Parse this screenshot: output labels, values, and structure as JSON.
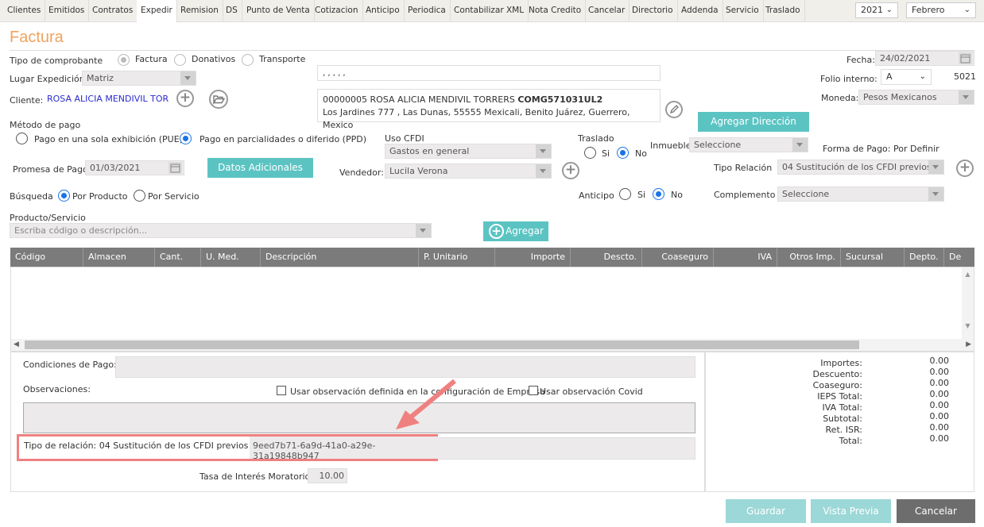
{
  "tabs": [
    "Clientes",
    "Emitidos",
    "Contratos",
    "Expedir",
    "Remision",
    "DS",
    "Punto de Venta",
    "Cotizacion",
    "Anticipo",
    "Periodica",
    "Contabilizar XML",
    "Nota Credito",
    "Cancelar",
    "Directorio",
    "Addenda",
    "Servicio",
    "Traslado"
  ],
  "year": "2021",
  "month": "Febrero",
  "title": "Factura",
  "tipo_comprobante": {
    "label": "Tipo de comprobante",
    "opts": [
      "Factura",
      "Donativos",
      "Transporte"
    ]
  },
  "lugar": {
    "label": "Lugar Expedición",
    "value": "Matriz"
  },
  "cliente": {
    "label": "Cliente:",
    "value": "ROSA ALICIA MENDIVIL TORRE"
  },
  "address_line": ", , , , ,",
  "client_box": {
    "code": "00000005 ROSA ALICIA MENDIVIL TORRERS ",
    "rfc": "COMG571031UL2",
    "address": "Los Jardines 777 , Las Dunas, 55555 Mexicali, Benito Juárez, Guerrero, Mexico"
  },
  "fecha": {
    "label": "Fecha:",
    "value": "24/02/2021"
  },
  "folio": {
    "label": "Folio interno:",
    "serie": "A",
    "number": "5021"
  },
  "moneda": {
    "label": "Moneda:",
    "value": "Pesos Mexicanos"
  },
  "agregar_direccion": "Agregar Dirección",
  "metodo": {
    "label": "Método de pago",
    "pue": "Pago en una sola exhibición (PUE)",
    "ppd": "Pago en parcialidades o diferido (PPD)"
  },
  "uso_cfdi": {
    "label": "Uso CFDI",
    "value": "Gastos en general"
  },
  "traslado": {
    "label": "Traslado",
    "si": "Si",
    "no": "No"
  },
  "inmueble": {
    "label": "Inmueble",
    "value": "Seleccione"
  },
  "forma_pago": "Forma de Pago: Por Definir",
  "promesa": {
    "label": "Promesa de Pago",
    "value": "01/03/2021"
  },
  "datos_adicionales": "Datos Adicionales",
  "vendedor": {
    "label": "Vendedor:",
    "value": "Lucila Verona"
  },
  "tipo_relacion": {
    "label": "Tipo Relación",
    "value": "04 Sustitución de los CFDI previos"
  },
  "busqueda": {
    "label": "Búsqueda",
    "producto": "Por Producto",
    "servicio": "Por Servicio"
  },
  "anticipo": {
    "label": "Anticipo",
    "si": "Si",
    "no": "No"
  },
  "complemento": {
    "label": "Complemento",
    "value": "Seleccione"
  },
  "producto": {
    "label": "Producto/Servicio",
    "placeholder": "Escriba código o descripción..."
  },
  "agregar": "Agregar",
  "columns": [
    "Código",
    "Almacen",
    "Cant.",
    "U. Med.",
    "Descripción",
    "P. Unitario",
    "Importe",
    "Descto.",
    "Coaseguro",
    "IVA",
    "Otros Imp.",
    "Sucursal",
    "Depto.",
    "De"
  ],
  "condiciones": "Condiciones de Pago:",
  "observaciones": "Observaciones:",
  "obs_empresa": "Usar observación definida en la configuración de Empresa",
  "obs_covid": "Usar observación Covid",
  "relacion_line": {
    "label": "Tipo de relación:  04 Sustitución de los CFDI previos",
    "uuid": "9eed7b71-6a9d-41a0-a29e-31a19848b947"
  },
  "tasa": {
    "label": "Tasa de Interés Moratorio",
    "value": "10.00"
  },
  "totals": [
    {
      "label": "Importes:",
      "value": "0.00"
    },
    {
      "label": "Descuento:",
      "value": "0.00"
    },
    {
      "label": "Coaseguro:",
      "value": "0.00"
    },
    {
      "label": "IEPS Total:",
      "value": "0.00"
    },
    {
      "label": "IVA Total:",
      "value": "0.00"
    },
    {
      "label": "Subtotal:",
      "value": "0.00"
    },
    {
      "label": "Ret. ISR:",
      "value": "0.00"
    },
    {
      "label": "Total:",
      "value": "0.00"
    }
  ],
  "buttons": {
    "guardar": "Guardar",
    "vista": "Vista Previa",
    "cancelar": "Cancelar"
  },
  "colors": {
    "accent": "#f0a35e",
    "teal": "#5bc4c3",
    "highlight": "#f08080"
  }
}
